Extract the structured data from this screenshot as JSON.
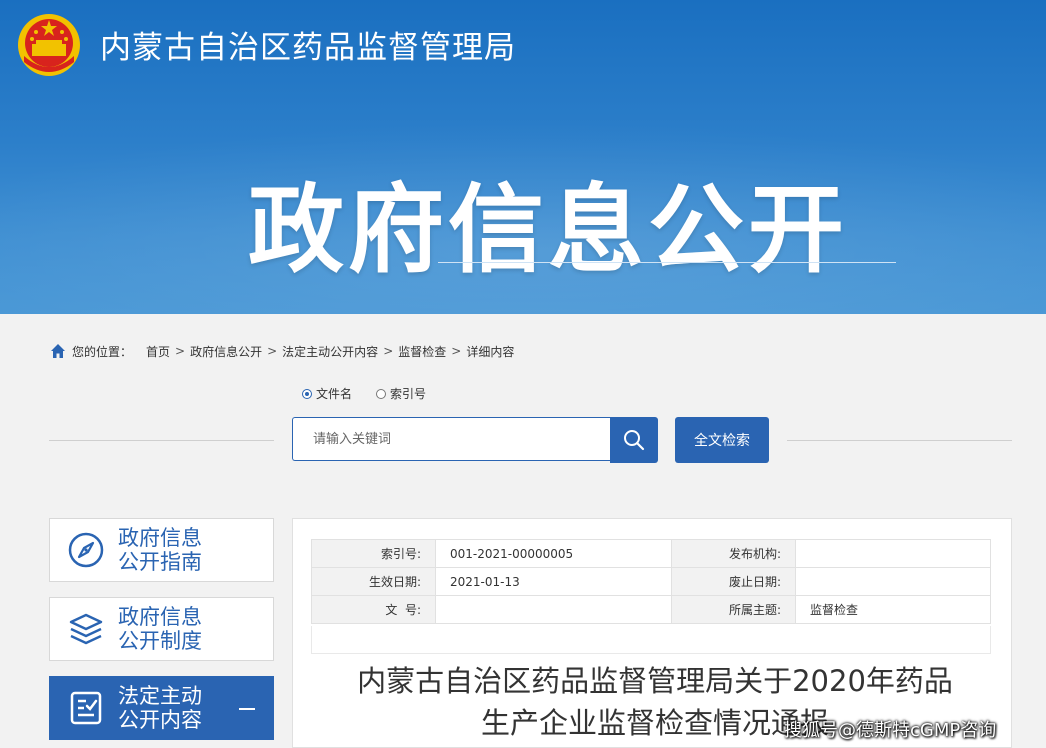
{
  "header": {
    "site_title": "内蒙古自治区药品监督管理局",
    "hero_title": "政府信息公开"
  },
  "breadcrumb": {
    "label": "您的位置：",
    "items": [
      "首页",
      "政府信息公开",
      "法定主动公开内容",
      "监督检查",
      "详细内容"
    ],
    "separator": ">"
  },
  "search": {
    "options": [
      {
        "label": "文件名",
        "selected": true
      },
      {
        "label": "索引号",
        "selected": false
      }
    ],
    "placeholder": "请输入关键词",
    "fulltext_label": "全文检索"
  },
  "sidebar": {
    "items": [
      {
        "label": "政府信息\n公开指南",
        "icon": "compass-icon",
        "active": false
      },
      {
        "label": "政府信息\n公开制度",
        "icon": "layers-icon",
        "active": false
      },
      {
        "label": "法定主动\n公开内容",
        "icon": "document-check-icon",
        "active": true
      }
    ]
  },
  "meta": {
    "index_no_label": "索引号:",
    "index_no": "001-2021-00000005",
    "publisher_label": "发布机构:",
    "publisher": "",
    "effective_label": "生效日期:",
    "effective_date": "2021-01-13",
    "repeal_label": "废止日期:",
    "repeal_date": "",
    "doc_no_label": "文  号:",
    "doc_no": "",
    "topic_label": "所属主题:",
    "topic": "监督检查"
  },
  "document": {
    "title": "内蒙古自治区药品监督管理局关于2020年药品\n生产企业监督检查情况通报"
  },
  "watermark": "搜狐号@德斯特cGMP咨询",
  "colors": {
    "brand_blue": "#2a64b2",
    "hero_blue": "#2c7fca"
  }
}
